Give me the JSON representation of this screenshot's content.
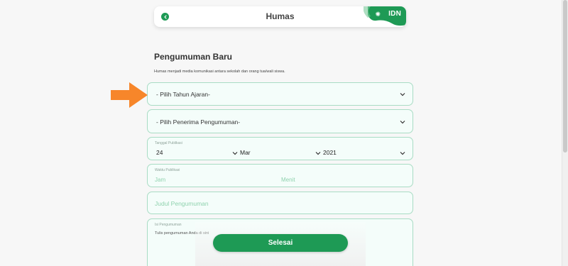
{
  "header": {
    "title": "Humas",
    "logo_text": "IDN",
    "back_icon": "chevron-left-icon"
  },
  "form": {
    "title": "Pengumuman Baru",
    "description": "Humas menjadi media komunikasi antara sekolah dan orang tua/wali siswa.",
    "tahun_ajaran_placeholder": "- Pilih Tahun Ajaran-",
    "penerima_placeholder": "- Pilih Penerima Pengumuman-",
    "tanggal_label": "Tanggal Publikasi",
    "tanggal_day": "24",
    "tanggal_month": "Mar",
    "tanggal_year": "2021",
    "waktu_label": "Waktu Publikasi",
    "jam_placeholder": "Jam",
    "menit_placeholder": "Menit",
    "judul_placeholder": "Judul Pengumuman",
    "isi_label": "Isi Pengumuman",
    "isi_placeholder": "Tulis pengumuman Anda di sini",
    "submit_label": "Selesai"
  },
  "colors": {
    "brand_green": "#1e9a55",
    "field_bg": "#f4fdfa",
    "field_border": "#a9dcc4",
    "annotation_arrow": "#f7862a"
  }
}
